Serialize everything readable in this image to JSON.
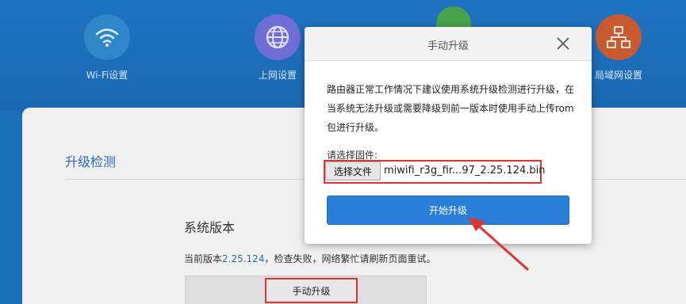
{
  "nav": {
    "items": [
      {
        "label": "Wi-Fi设置",
        "icon": "wifi-icon",
        "color": "#2f86c8"
      },
      {
        "label": "上网设置",
        "icon": "globe-icon",
        "color": "#6f6dd6"
      },
      {
        "label": "",
        "icon": "partial-icon",
        "color": "#4aa24a"
      },
      {
        "label": "局域网设置",
        "icon": "network-icon",
        "color": "#c9592f"
      }
    ]
  },
  "page": {
    "section_title": "升级检测",
    "system_version_title": "系统版本",
    "status_prefix": "当前版本",
    "current_version": "2.25.124",
    "status_suffix": "，检查失败，网络繁忙请刷新页面重试。",
    "manual_upgrade_label": "手动升级"
  },
  "modal": {
    "title": "手动升级",
    "description": "路由器正常工作情况下建议使用系统升级检测进行升级，在当系统无法升级或需要降级到前一版本时使用手动上传rom包进行升级。",
    "firmware_label": "请选择固件:",
    "choose_file_label": "选择文件",
    "file_name": "miwifi_r3g_fir...97_2.25.124.bin",
    "start_upgrade_label": "开始升级"
  },
  "colors": {
    "brand_blue": "#1f73c1",
    "accent_blue": "#2a7fd6",
    "highlight_red": "#e0322e"
  }
}
